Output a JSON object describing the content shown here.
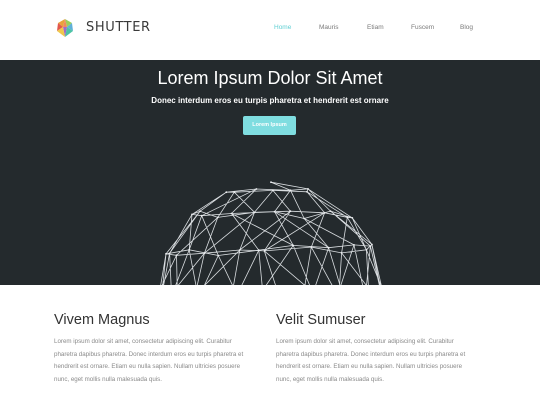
{
  "brand": {
    "name": "SHUTTER",
    "logo_icon": "colorful-gem-logo-icon"
  },
  "nav": {
    "items": [
      {
        "label": "Home",
        "active": true
      },
      {
        "label": "Mauris",
        "active": false
      },
      {
        "label": "Etiam",
        "active": false
      },
      {
        "label": "Fuscem",
        "active": false
      },
      {
        "label": "Blog",
        "active": false
      }
    ],
    "active_color": "#5fcfd3"
  },
  "hero": {
    "title": "Lorem Ipsum Dolor Sit Amet",
    "subtitle": "Donec interdum eros eu turpis pharetra et hendrerit est ornare",
    "button_label": "Lorem Ipsum",
    "background_color": "#242a2d",
    "button_color": "#7fdde0",
    "graphic": "wireframe-sphere"
  },
  "columns": [
    {
      "heading": "Vivem Magnus",
      "lines": [
        "Lorem ipsum dolor sit amet, consectetur adipiscing elit. Curabitur",
        "pharetra dapibus pharetra. Donec interdum eros eu turpis pharetra et",
        "hendrerit est ornare. Etiam eu nulla sapien. Nullam ultricies posuere",
        "nunc, eget mollis nulla malesuada quis."
      ]
    },
    {
      "heading": "Velit Sumuser",
      "lines": [
        "Lorem ipsum dolor sit amet, consectetur adipiscing elit. Curabitur",
        "pharetra dapibus pharetra. Donec interdum eros eu turpis pharetra et",
        "hendrerit est ornare. Etiam eu nulla sapien. Nullam ultricies posuere",
        "nunc, eget mollis nulla malesuada quis."
      ]
    }
  ]
}
